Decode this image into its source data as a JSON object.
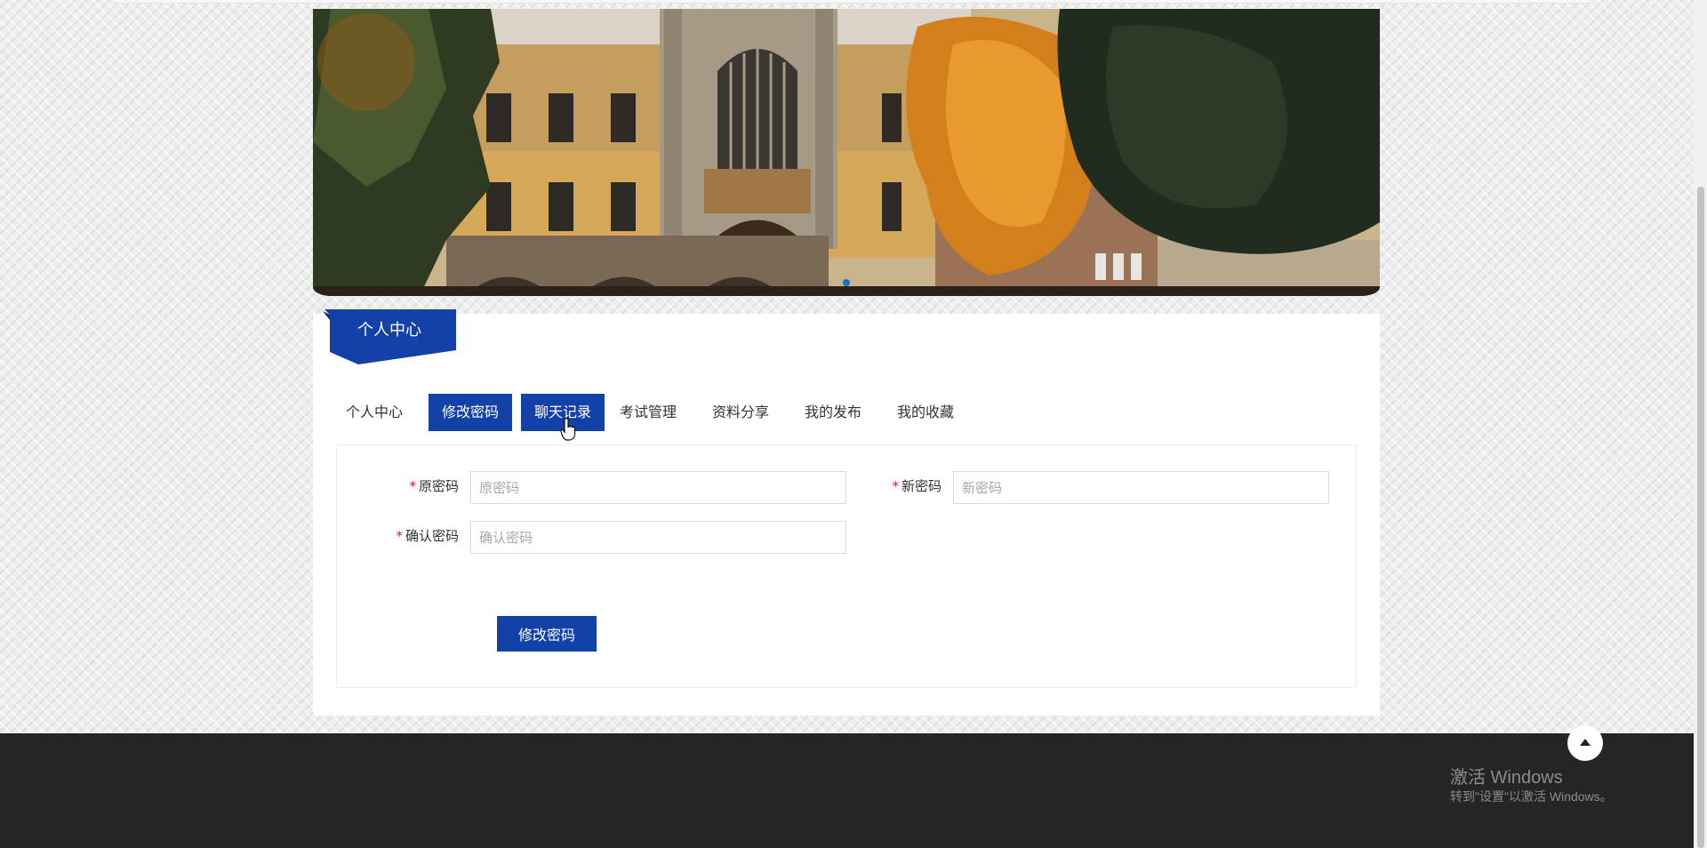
{
  "banner": {
    "image": "university-building-autumn-photo"
  },
  "section": {
    "ribbon_title": "个人中心"
  },
  "tabs": [
    {
      "label": "个人中心",
      "active": false
    },
    {
      "label": "修改密码",
      "active": true
    },
    {
      "label": "聊天记录",
      "active": true
    },
    {
      "label": "考试管理",
      "active": false
    },
    {
      "label": "资料分享",
      "active": false
    },
    {
      "label": "我的发布",
      "active": false
    },
    {
      "label": "我的收藏",
      "active": false
    }
  ],
  "form": {
    "required_mark": "*",
    "old_password": {
      "label": "原密码",
      "placeholder": "原密码",
      "value": ""
    },
    "new_password": {
      "label": "新密码",
      "placeholder": "新密码",
      "value": ""
    },
    "confirm_password": {
      "label": "确认密码",
      "placeholder": "确认密码",
      "value": ""
    },
    "submit_label": "修改密码"
  },
  "footer": {
    "back_to_top_icon": "arrow-up-icon"
  },
  "watermark": {
    "title": "激活 Windows",
    "subtitle": "转到\"设置\"以激活 Windows。"
  },
  "colors": {
    "primary": "#1241a8",
    "footer_bg": "#252525",
    "required": "#e0141e"
  }
}
